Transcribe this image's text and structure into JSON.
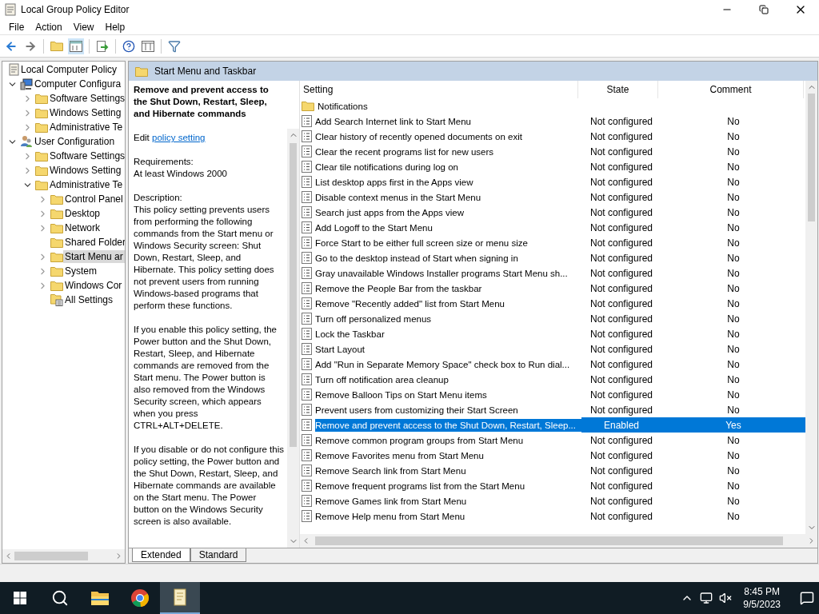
{
  "window": {
    "title": "Local Group Policy Editor"
  },
  "menu": [
    "File",
    "Action",
    "View",
    "Help"
  ],
  "toolbar": [
    {
      "kind": "back"
    },
    {
      "kind": "forward"
    },
    {
      "kind": "sep"
    },
    {
      "kind": "up"
    },
    {
      "kind": "pane"
    },
    {
      "kind": "sep"
    },
    {
      "kind": "export"
    },
    {
      "kind": "sep"
    },
    {
      "kind": "help"
    },
    {
      "kind": "view"
    },
    {
      "kind": "sep"
    },
    {
      "kind": "filter"
    }
  ],
  "tree": [
    {
      "label": "Local Computer Policy",
      "kind": "root",
      "selected": false,
      "children": [
        {
          "label": "Computer Configura",
          "kind": "computer",
          "expanded": true,
          "selected": false,
          "children": [
            {
              "label": "Software Settings",
              "kind": "folder",
              "expanded": false,
              "selected": false
            },
            {
              "label": "Windows Setting",
              "kind": "folder",
              "expanded": false,
              "selected": false
            },
            {
              "label": "Administrative Te",
              "kind": "folder",
              "expanded": false,
              "selected": false
            }
          ]
        },
        {
          "label": "User Configuration",
          "kind": "user",
          "expanded": true,
          "selected": false,
          "children": [
            {
              "label": "Software Settings",
              "kind": "folder",
              "expanded": false,
              "selected": false
            },
            {
              "label": "Windows Setting",
              "kind": "folder",
              "expanded": false,
              "selected": false
            },
            {
              "label": "Administrative Te",
              "kind": "folder",
              "expanded": true,
              "selected": false,
              "children": [
                {
                  "label": "Control Panel",
                  "kind": "folder",
                  "expanded": false,
                  "selected": false
                },
                {
                  "label": "Desktop",
                  "kind": "folder",
                  "expanded": false,
                  "selected": false
                },
                {
                  "label": "Network",
                  "kind": "folder",
                  "expanded": false,
                  "selected": false
                },
                {
                  "label": "Shared Folder",
                  "kind": "folder",
                  "selected": false
                },
                {
                  "label": "Start Menu ar",
                  "kind": "folder",
                  "expanded": false,
                  "selected": true
                },
                {
                  "label": "System",
                  "kind": "folder",
                  "expanded": false,
                  "selected": false
                },
                {
                  "label": "Windows Cor",
                  "kind": "folder",
                  "expanded": false,
                  "selected": false
                },
                {
                  "label": "All Settings",
                  "kind": "all",
                  "selected": false
                }
              ]
            }
          ]
        }
      ]
    }
  ],
  "panel_title": "Start Menu and Taskbar",
  "details": {
    "title": "Remove and prevent access to the Shut Down, Restart, Sleep, and Hibernate commands",
    "edit_prefix": "Edit",
    "edit_link": "policy setting",
    "requirements_label": "Requirements:",
    "requirements_value": "At least Windows 2000",
    "description_label": "Description:",
    "paragraphs": [
      "This policy setting prevents users from performing the following commands from the Start menu or Windows Security screen: Shut Down, Restart, Sleep, and Hibernate. This policy setting does not prevent users from running Windows-based programs that perform these functions.",
      "If you enable this policy setting, the Power button and the Shut Down, Restart, Sleep, and Hibernate commands are removed from the Start menu. The Power button is also removed from the Windows Security screen, which appears when you press CTRL+ALT+DELETE.",
      "If you disable or do not configure this policy setting, the Power button and the Shut Down, Restart, Sleep, and Hibernate commands are available on the Start menu. The Power button on the Windows Security screen is also available."
    ]
  },
  "table": {
    "columns": [
      "Setting",
      "State",
      "Comment"
    ],
    "rows": [
      {
        "kind": "folder",
        "setting": "Notifications",
        "selected": false
      },
      {
        "kind": "policy",
        "setting": "Add Search Internet link to Start Menu",
        "state": "Not configured",
        "comment": "No",
        "selected": false
      },
      {
        "kind": "policy",
        "setting": "Clear history of recently opened documents on exit",
        "state": "Not configured",
        "comment": "No",
        "selected": false
      },
      {
        "kind": "policy",
        "setting": "Clear the recent programs list for new users",
        "state": "Not configured",
        "comment": "No",
        "selected": false
      },
      {
        "kind": "policy",
        "setting": "Clear tile notifications during log on",
        "state": "Not configured",
        "comment": "No",
        "selected": false
      },
      {
        "kind": "policy",
        "setting": "List desktop apps first in the Apps view",
        "state": "Not configured",
        "comment": "No",
        "selected": false
      },
      {
        "kind": "policy",
        "setting": "Disable context menus in the Start Menu",
        "state": "Not configured",
        "comment": "No",
        "selected": false
      },
      {
        "kind": "policy",
        "setting": "Search just apps from the Apps view",
        "state": "Not configured",
        "comment": "No",
        "selected": false
      },
      {
        "kind": "policy",
        "setting": "Add Logoff to the Start Menu",
        "state": "Not configured",
        "comment": "No",
        "selected": false
      },
      {
        "kind": "policy",
        "setting": "Force Start to be either full screen size or menu size",
        "state": "Not configured",
        "comment": "No",
        "selected": false
      },
      {
        "kind": "policy",
        "setting": "Go to the desktop instead of Start when signing in",
        "state": "Not configured",
        "comment": "No",
        "selected": false
      },
      {
        "kind": "policy",
        "setting": "Gray unavailable Windows Installer programs Start Menu sh...",
        "state": "Not configured",
        "comment": "No",
        "selected": false
      },
      {
        "kind": "policy",
        "setting": "Remove the People Bar from the taskbar",
        "state": "Not configured",
        "comment": "No",
        "selected": false
      },
      {
        "kind": "policy",
        "setting": "Remove \"Recently added\" list from Start Menu",
        "state": "Not configured",
        "comment": "No",
        "selected": false
      },
      {
        "kind": "policy",
        "setting": "Turn off personalized menus",
        "state": "Not configured",
        "comment": "No",
        "selected": false
      },
      {
        "kind": "policy",
        "setting": "Lock the Taskbar",
        "state": "Not configured",
        "comment": "No",
        "selected": false
      },
      {
        "kind": "policy",
        "setting": "Start Layout",
        "state": "Not configured",
        "comment": "No",
        "selected": false
      },
      {
        "kind": "policy",
        "setting": "Add \"Run in Separate Memory Space\" check box to Run dial...",
        "state": "Not configured",
        "comment": "No",
        "selected": false
      },
      {
        "kind": "policy",
        "setting": "Turn off notification area cleanup",
        "state": "Not configured",
        "comment": "No",
        "selected": false
      },
      {
        "kind": "policy",
        "setting": "Remove Balloon Tips on Start Menu items",
        "state": "Not configured",
        "comment": "No",
        "selected": false
      },
      {
        "kind": "policy",
        "setting": "Prevent users from customizing their Start Screen",
        "state": "Not configured",
        "comment": "No",
        "selected": false
      },
      {
        "kind": "policy",
        "setting": "Remove and prevent access to the Shut Down, Restart, Sleep...",
        "state": "Enabled",
        "comment": "Yes",
        "selected": true
      },
      {
        "kind": "policy",
        "setting": "Remove common program groups from Start Menu",
        "state": "Not configured",
        "comment": "No",
        "selected": false
      },
      {
        "kind": "policy",
        "setting": "Remove Favorites menu from Start Menu",
        "state": "Not configured",
        "comment": "No",
        "selected": false
      },
      {
        "kind": "policy",
        "setting": "Remove Search link from Start Menu",
        "state": "Not configured",
        "comment": "No",
        "selected": false
      },
      {
        "kind": "policy",
        "setting": "Remove frequent programs list from the Start Menu",
        "state": "Not configured",
        "comment": "No",
        "selected": false
      },
      {
        "kind": "policy",
        "setting": "Remove Games link from Start Menu",
        "state": "Not configured",
        "comment": "No",
        "selected": false
      },
      {
        "kind": "policy",
        "setting": "Remove Help menu from Start Menu",
        "state": "Not configured",
        "comment": "No",
        "selected": false
      }
    ]
  },
  "view_tabs": [
    {
      "label": "Extended",
      "selected": true
    },
    {
      "label": "Standard",
      "selected": false
    }
  ],
  "taskbar": {
    "apps": [
      {
        "kind": "start",
        "active": false
      },
      {
        "kind": "search",
        "active": false
      },
      {
        "kind": "explorer",
        "active": false
      },
      {
        "kind": "browser",
        "active": false
      },
      {
        "kind": "editor",
        "active": true
      }
    ],
    "time": "8:45 PM",
    "date": "9/5/2023"
  }
}
